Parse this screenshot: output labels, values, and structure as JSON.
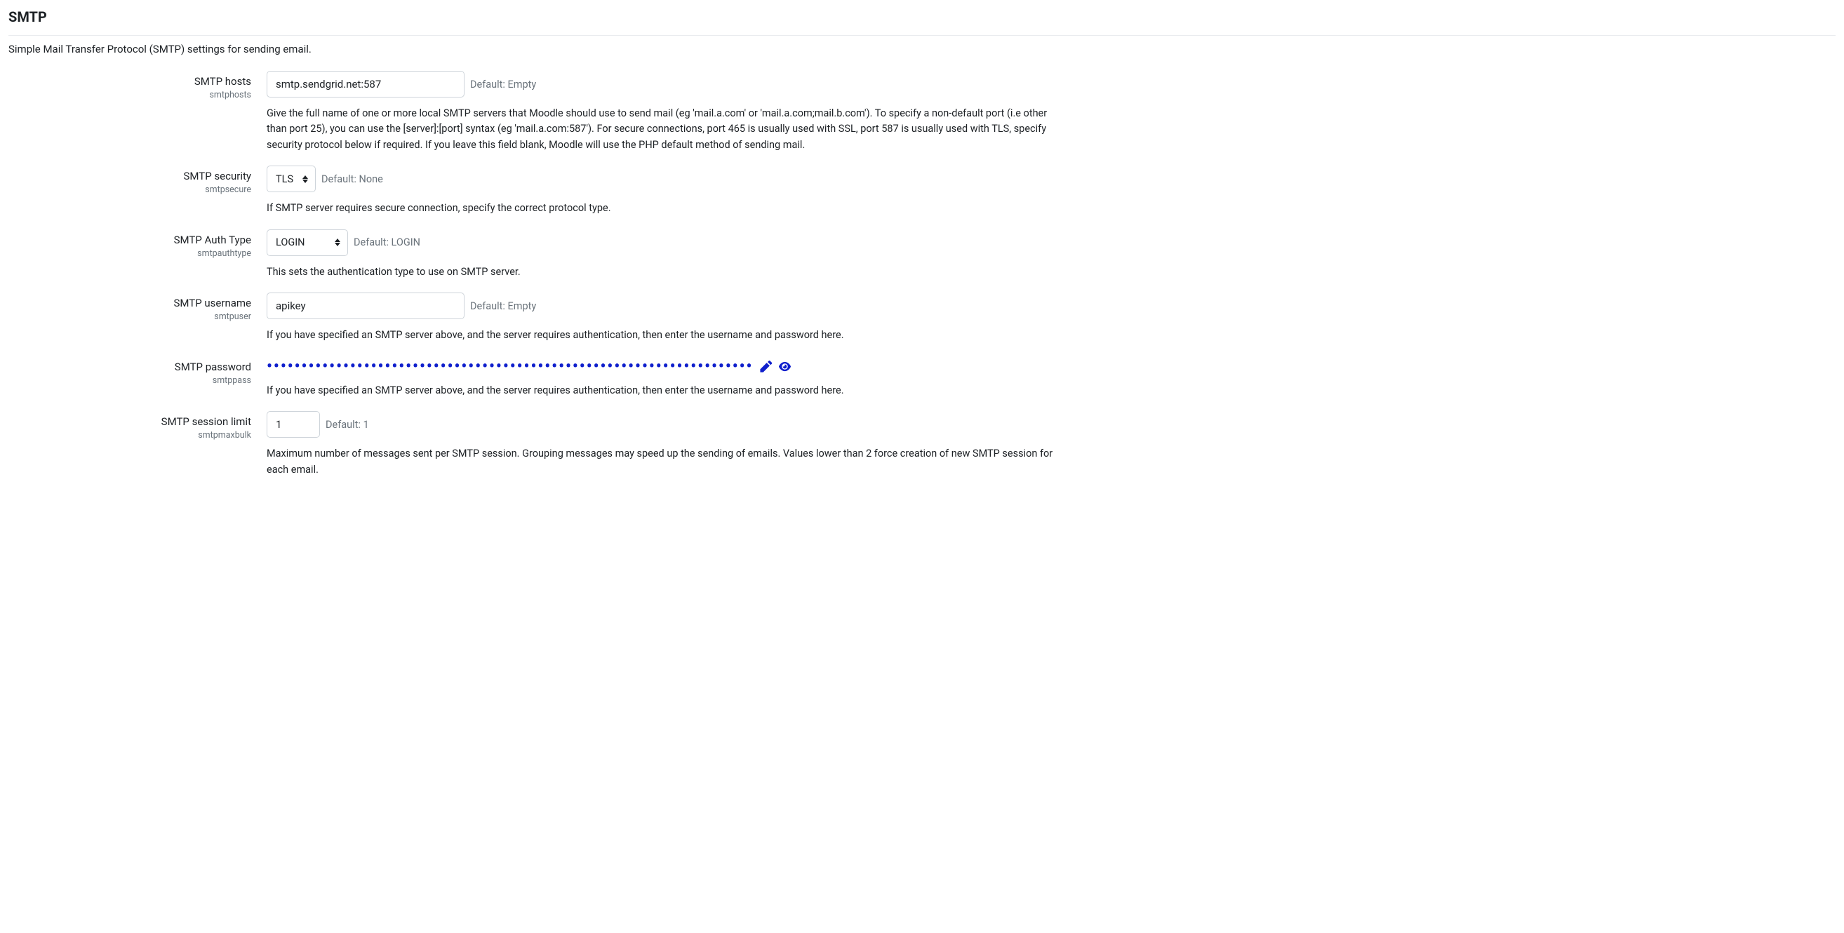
{
  "section": {
    "title": "SMTP",
    "description": "Simple Mail Transfer Protocol (SMTP) settings for sending email."
  },
  "default_prefix": "Default: ",
  "settings": {
    "smtphosts": {
      "label": "SMTP hosts",
      "name": "smtphosts",
      "value": "smtp.sendgrid.net:587",
      "default": "Empty",
      "help": "Give the full name of one or more local SMTP servers that Moodle should use to send mail (eg 'mail.a.com' or 'mail.a.com;mail.b.com'). To specify a non-default port (i.e other than port 25), you can use the [server]:[port] syntax (eg 'mail.a.com:587'). For secure connections, port 465 is usually used with SSL, port 587 is usually used with TLS, specify security protocol below if required. If you leave this field blank, Moodle will use the PHP default method of sending mail."
    },
    "smtpsecure": {
      "label": "SMTP security",
      "name": "smtpsecure",
      "value": "TLS",
      "default": "None",
      "help": "If SMTP server requires secure connection, specify the correct protocol type."
    },
    "smtpauthtype": {
      "label": "SMTP Auth Type",
      "name": "smtpauthtype",
      "value": "LOGIN",
      "default": "LOGIN",
      "help": "This sets the authentication type to use on SMTP server."
    },
    "smtpuser": {
      "label": "SMTP username",
      "name": "smtpuser",
      "value": "apikey",
      "default": "Empty",
      "help": "If you have specified an SMTP server above, and the server requires authentication, then enter the username and password here."
    },
    "smtppass": {
      "label": "SMTP password",
      "name": "smtppass",
      "mask": "••••••••••••••••••••••••••••••••••••••••••••••••••••••••••••••••••••••",
      "help": "If you have specified an SMTP server above, and the server requires authentication, then enter the username and password here."
    },
    "smtpmaxbulk": {
      "label": "SMTP session limit",
      "name": "smtpmaxbulk",
      "value": "1",
      "default": "1",
      "help": "Maximum number of messages sent per SMTP session. Grouping messages may speed up the sending of emails. Values lower than 2 force creation of new SMTP session for each email."
    }
  }
}
